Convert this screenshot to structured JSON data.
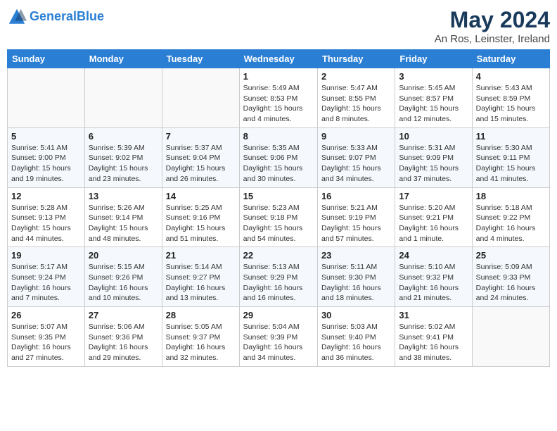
{
  "header": {
    "logo_line1": "General",
    "logo_line2": "Blue",
    "month": "May 2024",
    "location": "An Ros, Leinster, Ireland"
  },
  "weekdays": [
    "Sunday",
    "Monday",
    "Tuesday",
    "Wednesday",
    "Thursday",
    "Friday",
    "Saturday"
  ],
  "weeks": [
    [
      {
        "day": "",
        "info": ""
      },
      {
        "day": "",
        "info": ""
      },
      {
        "day": "",
        "info": ""
      },
      {
        "day": "1",
        "info": "Sunrise: 5:49 AM\nSunset: 8:53 PM\nDaylight: 15 hours\nand 4 minutes."
      },
      {
        "day": "2",
        "info": "Sunrise: 5:47 AM\nSunset: 8:55 PM\nDaylight: 15 hours\nand 8 minutes."
      },
      {
        "day": "3",
        "info": "Sunrise: 5:45 AM\nSunset: 8:57 PM\nDaylight: 15 hours\nand 12 minutes."
      },
      {
        "day": "4",
        "info": "Sunrise: 5:43 AM\nSunset: 8:59 PM\nDaylight: 15 hours\nand 15 minutes."
      }
    ],
    [
      {
        "day": "5",
        "info": "Sunrise: 5:41 AM\nSunset: 9:00 PM\nDaylight: 15 hours\nand 19 minutes."
      },
      {
        "day": "6",
        "info": "Sunrise: 5:39 AM\nSunset: 9:02 PM\nDaylight: 15 hours\nand 23 minutes."
      },
      {
        "day": "7",
        "info": "Sunrise: 5:37 AM\nSunset: 9:04 PM\nDaylight: 15 hours\nand 26 minutes."
      },
      {
        "day": "8",
        "info": "Sunrise: 5:35 AM\nSunset: 9:06 PM\nDaylight: 15 hours\nand 30 minutes."
      },
      {
        "day": "9",
        "info": "Sunrise: 5:33 AM\nSunset: 9:07 PM\nDaylight: 15 hours\nand 34 minutes."
      },
      {
        "day": "10",
        "info": "Sunrise: 5:31 AM\nSunset: 9:09 PM\nDaylight: 15 hours\nand 37 minutes."
      },
      {
        "day": "11",
        "info": "Sunrise: 5:30 AM\nSunset: 9:11 PM\nDaylight: 15 hours\nand 41 minutes."
      }
    ],
    [
      {
        "day": "12",
        "info": "Sunrise: 5:28 AM\nSunset: 9:13 PM\nDaylight: 15 hours\nand 44 minutes."
      },
      {
        "day": "13",
        "info": "Sunrise: 5:26 AM\nSunset: 9:14 PM\nDaylight: 15 hours\nand 48 minutes."
      },
      {
        "day": "14",
        "info": "Sunrise: 5:25 AM\nSunset: 9:16 PM\nDaylight: 15 hours\nand 51 minutes."
      },
      {
        "day": "15",
        "info": "Sunrise: 5:23 AM\nSunset: 9:18 PM\nDaylight: 15 hours\nand 54 minutes."
      },
      {
        "day": "16",
        "info": "Sunrise: 5:21 AM\nSunset: 9:19 PM\nDaylight: 15 hours\nand 57 minutes."
      },
      {
        "day": "17",
        "info": "Sunrise: 5:20 AM\nSunset: 9:21 PM\nDaylight: 16 hours\nand 1 minute."
      },
      {
        "day": "18",
        "info": "Sunrise: 5:18 AM\nSunset: 9:22 PM\nDaylight: 16 hours\nand 4 minutes."
      }
    ],
    [
      {
        "day": "19",
        "info": "Sunrise: 5:17 AM\nSunset: 9:24 PM\nDaylight: 16 hours\nand 7 minutes."
      },
      {
        "day": "20",
        "info": "Sunrise: 5:15 AM\nSunset: 9:26 PM\nDaylight: 16 hours\nand 10 minutes."
      },
      {
        "day": "21",
        "info": "Sunrise: 5:14 AM\nSunset: 9:27 PM\nDaylight: 16 hours\nand 13 minutes."
      },
      {
        "day": "22",
        "info": "Sunrise: 5:13 AM\nSunset: 9:29 PM\nDaylight: 16 hours\nand 16 minutes."
      },
      {
        "day": "23",
        "info": "Sunrise: 5:11 AM\nSunset: 9:30 PM\nDaylight: 16 hours\nand 18 minutes."
      },
      {
        "day": "24",
        "info": "Sunrise: 5:10 AM\nSunset: 9:32 PM\nDaylight: 16 hours\nand 21 minutes."
      },
      {
        "day": "25",
        "info": "Sunrise: 5:09 AM\nSunset: 9:33 PM\nDaylight: 16 hours\nand 24 minutes."
      }
    ],
    [
      {
        "day": "26",
        "info": "Sunrise: 5:07 AM\nSunset: 9:35 PM\nDaylight: 16 hours\nand 27 minutes."
      },
      {
        "day": "27",
        "info": "Sunrise: 5:06 AM\nSunset: 9:36 PM\nDaylight: 16 hours\nand 29 minutes."
      },
      {
        "day": "28",
        "info": "Sunrise: 5:05 AM\nSunset: 9:37 PM\nDaylight: 16 hours\nand 32 minutes."
      },
      {
        "day": "29",
        "info": "Sunrise: 5:04 AM\nSunset: 9:39 PM\nDaylight: 16 hours\nand 34 minutes."
      },
      {
        "day": "30",
        "info": "Sunrise: 5:03 AM\nSunset: 9:40 PM\nDaylight: 16 hours\nand 36 minutes."
      },
      {
        "day": "31",
        "info": "Sunrise: 5:02 AM\nSunset: 9:41 PM\nDaylight: 16 hours\nand 38 minutes."
      },
      {
        "day": "",
        "info": ""
      }
    ]
  ]
}
